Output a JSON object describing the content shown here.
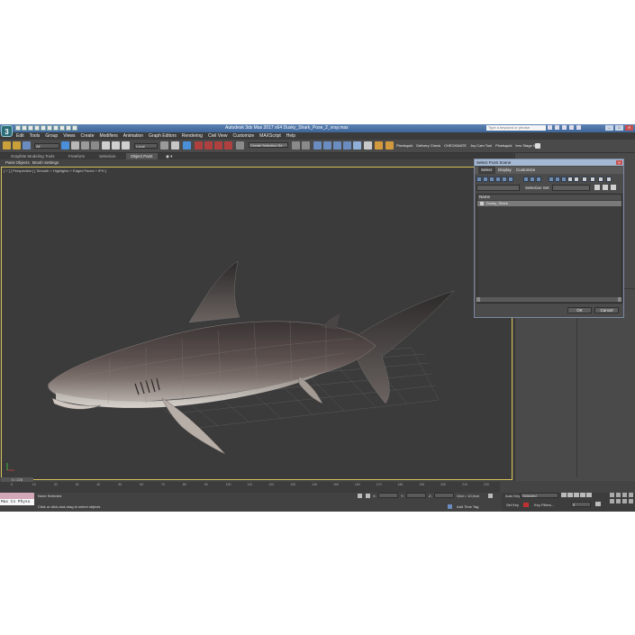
{
  "app": {
    "title": "Autodesk 3ds Max 2017 x64    Dusky_Shark_Pose_2_vray.max",
    "search_placeholder": "Type a keyword or phrase",
    "logo_glyph": "3"
  },
  "menu": [
    "Edit",
    "Tools",
    "Group",
    "Views",
    "Create",
    "Modifiers",
    "Animation",
    "Graph Editors",
    "Rendering",
    "Civil View",
    "Customize",
    "MAXScript",
    "Help"
  ],
  "toolbar": {
    "filter_value": "All",
    "coord_value": "Local",
    "selection_set_value": "Create Selection Se",
    "right_labels": [
      "Pixelsquid",
      "Delivery Check",
      "CHECKMATE",
      "Joy Cam Tool",
      "Pixelsquid",
      "Iero Stage 01"
    ]
  },
  "ribbon": {
    "tabs": [
      "Graphite Modeling Tools",
      "Freeform",
      "Selection",
      "Object Paint"
    ],
    "active_tab": "Object Paint",
    "sub_items": [
      "Paint Objects",
      "Brush Settings"
    ]
  },
  "viewport": {
    "label": "[ + ] [ Perspective ] [ Smooth + Highlights + Edged Faces + iPH ]"
  },
  "dialog": {
    "title": "Select From Scene",
    "close_label": "X",
    "menus": [
      "Select",
      "Display",
      "Customize"
    ],
    "find_label": "Find:",
    "selection_set_label": "Selection Set:",
    "column_name": "Name",
    "items": [
      "Dusky_Shark"
    ],
    "ok_label": "OK",
    "cancel_label": "Cancel"
  },
  "timeline": {
    "slider_label": "0 / 225",
    "ticks": [
      "0",
      "10",
      "20",
      "30",
      "40",
      "50",
      "60",
      "70",
      "80",
      "90",
      "100",
      "110",
      "120",
      "130",
      "140",
      "150",
      "160",
      "170",
      "180",
      "190",
      "200",
      "210",
      "220"
    ]
  },
  "status": {
    "maxscript_text": "Max to Physx",
    "selection_text": "None Selected",
    "prompt_text": "Click or click-and-drag to select objects",
    "x_label": "X:",
    "y_label": "Y:",
    "z_label": "Z:",
    "grid_text": "Grid = 10,0cm",
    "add_time_tag": "Add Time Tag",
    "auto_key_label": "Auto Key",
    "auto_key_value": "Selected",
    "set_key_label": "Set Key",
    "key_filters_label": "Key Filters...",
    "frame_value": "0"
  },
  "colors": {
    "title_bar": "#4a73a6",
    "auto_key_red": "#c03030",
    "viewport_border": "#d8c25a",
    "maxscript_pink": "#d4a7b8"
  }
}
